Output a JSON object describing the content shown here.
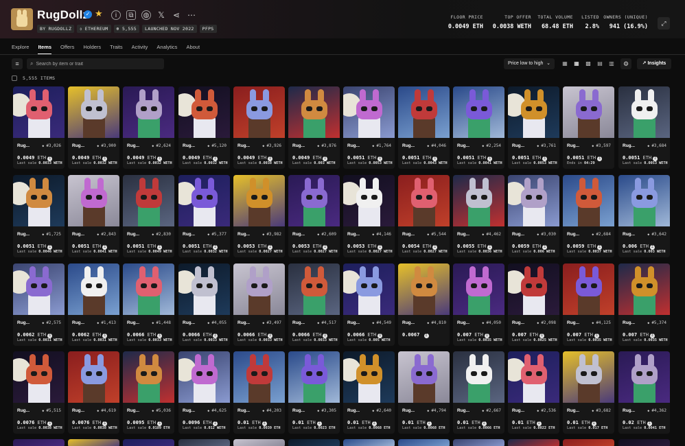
{
  "collection": {
    "name": "RugDollz",
    "chips": [
      "BY RUGDOLLZ",
      "⬨ ETHEREUM",
      "⊕ 5,555",
      "LAUNCHED NOV 2022",
      "PFPS"
    ]
  },
  "stats": [
    {
      "label": "FLOOR PRICE",
      "value": "0.0049 ETH"
    },
    {
      "label": "TOP OFFER",
      "value": "0.0038 WETH"
    },
    {
      "label": "TOTAL VOLUME",
      "value": "68.48 ETH"
    },
    {
      "label": "LISTED",
      "value": "2.8%"
    },
    {
      "label": "OWNERS (UNIQUE)",
      "value": "941 (16.9%)"
    }
  ],
  "tabs": [
    "Explore",
    "Items",
    "Offers",
    "Holders",
    "Traits",
    "Activity",
    "Analytics",
    "About"
  ],
  "active_tab": "Items",
  "toolbar": {
    "search_placeholder": "Search by item or trait",
    "sort_label": "Price low to high",
    "insights_label": "Insights",
    "items_count": "5,555 ITEMS"
  },
  "icons": {
    "info": "info-icon",
    "copy": "copy-icon",
    "web": "globe-icon",
    "x": "x-icon",
    "share": "share-icon",
    "more": "more-icon"
  },
  "colors": {
    "verified": "#2081e2",
    "star": "#f3c33b",
    "background": "#0d0d0d",
    "card": "#171717"
  },
  "items": [
    {
      "name": "Rug...",
      "id": "#3,026",
      "price": "0.0049",
      "unit": "ETH",
      "last": "Last sale",
      "last_value": "0.0033 WETH"
    },
    {
      "name": "Rug...",
      "id": "#3,900",
      "price": "0.0049",
      "unit": "ETH",
      "last": "Last sale",
      "last_value": "0.0032 WETH"
    },
    {
      "name": "Rug...",
      "id": "#2,624",
      "price": "0.0049",
      "unit": "ETH",
      "last": "Last sale",
      "last_value": "0.0032 WETH"
    },
    {
      "name": "Rug...",
      "id": "#5,120",
      "price": "0.0049",
      "unit": "ETH",
      "last": "Last sale",
      "last_value": "0.0032 WETH"
    },
    {
      "name": "Rug...",
      "id": "#3,926",
      "price": "0.0049",
      "unit": "ETH",
      "last": "Last sale",
      "last_value": "0.0038 WETH"
    },
    {
      "name": "Rug...",
      "id": "#3,876",
      "price": "0.0049",
      "unit": "ETH",
      "last": "Last sale",
      "last_value": "0.003 WETH"
    },
    {
      "name": "Rug...",
      "id": "#1,764",
      "price": "0.0051",
      "unit": "ETH",
      "last": "Last sale",
      "last_value": "0.0053 WETH"
    },
    {
      "name": "Rug...",
      "id": "#4,046",
      "price": "0.0051",
      "unit": "ETH",
      "last": "Last sale",
      "last_value": "0.0043 WETH"
    },
    {
      "name": "Rug...",
      "id": "#2,254",
      "price": "0.0051",
      "unit": "ETH",
      "last": "Last sale",
      "last_value": "0.0041 WETH"
    },
    {
      "name": "Rug...",
      "id": "#3,761",
      "price": "0.0051",
      "unit": "ETH",
      "last": "Last sale",
      "last_value": "0.0053 WETH"
    },
    {
      "name": "Rug...",
      "id": "#3,597",
      "price": "0.0051",
      "unit": "ETH",
      "last": "Ends in",
      "last_value": "04:29"
    },
    {
      "name": "Rug...",
      "id": "#3,684",
      "price": "0.0051",
      "unit": "ETH",
      "last": "Last sale",
      "last_value": "0.0053 WETH"
    },
    {
      "name": "Rug...",
      "id": "#1,725",
      "price": "0.0051",
      "unit": "ETH",
      "last": "Last sale",
      "last_value": "0.0046 WETH"
    },
    {
      "name": "Rug...",
      "id": "#2,843",
      "price": "0.0051",
      "unit": "ETH",
      "last": "Last sale",
      "last_value": "0.0041 WETH"
    },
    {
      "name": "Rug...",
      "id": "#2,830",
      "price": "0.0051",
      "unit": "ETH",
      "last": "Last sale",
      "last_value": "0.0049 WETH"
    },
    {
      "name": "Rug...",
      "id": "#5,377",
      "price": "0.0051",
      "unit": "ETH",
      "last": "Last sale",
      "last_value": "0.0032 WETH"
    },
    {
      "name": "Rug...",
      "id": "#3,982",
      "price": "0.0053",
      "unit": "ETH",
      "last": "Last sale",
      "last_value": "0.0027 WETH"
    },
    {
      "name": "Rug...",
      "id": "#2,609",
      "price": "0.0053",
      "unit": "ETH",
      "last": "Last sale",
      "last_value": "0.0027 WETH"
    },
    {
      "name": "Rug...",
      "id": "#4,146",
      "price": "0.0053",
      "unit": "ETH",
      "last": "Last sale",
      "last_value": "0.0027 WETH"
    },
    {
      "name": "Rug...",
      "id": "#5,544",
      "price": "0.0054",
      "unit": "ETH",
      "last": "Last sale",
      "last_value": "0.0027 WETH"
    },
    {
      "name": "Rug...",
      "id": "#4,462",
      "price": "0.0055",
      "unit": "ETH",
      "last": "Last sale",
      "last_value": "0.0036 WETH"
    },
    {
      "name": "Rug...",
      "id": "#3,030",
      "price": "0.0059",
      "unit": "ETH",
      "last": "Last sale",
      "last_value": "0.006 WETH"
    },
    {
      "name": "Rug...",
      "id": "#2,684",
      "price": "0.0059",
      "unit": "ETH",
      "last": "Last sale",
      "last_value": "0.0037 WETH"
    },
    {
      "name": "Rug...",
      "id": "#3,642",
      "price": "0.006",
      "unit": "ETH",
      "last": "Last sale",
      "last_value": "0.003 WETH"
    },
    {
      "name": "Rug...",
      "id": "#2,575",
      "price": "0.0062",
      "unit": "ETH",
      "last": "Last sale",
      "last_value": "0.0031 WETH"
    },
    {
      "name": "Rug...",
      "id": "#1,413",
      "price": "0.0062",
      "unit": "ETH",
      "last": "Last sale",
      "last_value": "0.0031 WETH"
    },
    {
      "name": "Rug...",
      "id": "#1,448",
      "price": "0.0066",
      "unit": "ETH",
      "last": "Last sale",
      "last_value": "0.0033 WETH"
    },
    {
      "name": "Rug...",
      "id": "#4,055",
      "price": "0.0066",
      "unit": "ETH",
      "last": "Last sale",
      "last_value": "0.0033 WETH"
    },
    {
      "name": "Rug...",
      "id": "#3,497",
      "price": "0.0066",
      "unit": "ETH",
      "last": "Last sale",
      "last_value": "0.0033 WETH"
    },
    {
      "name": "Rug...",
      "id": "#4,517",
      "price": "0.0066",
      "unit": "ETH",
      "last": "Last sale",
      "last_value": "0.0033 WETH"
    },
    {
      "name": "Rug...",
      "id": "#4,549",
      "price": "0.0066",
      "unit": "ETH",
      "last": "Last sale",
      "last_value": "0.005 WETH"
    },
    {
      "name": "Rug...",
      "id": "#4,810",
      "price": "0.0067",
      "unit": "",
      "last": "",
      "last_value": ""
    },
    {
      "name": "Rug...",
      "id": "#4,050",
      "price": "0.007",
      "unit": "ETH",
      "last": "Last sale",
      "last_value": "0.0035 WETH"
    },
    {
      "name": "Rug...",
      "id": "#2,098",
      "price": "0.007",
      "unit": "ETH",
      "last": "Last sale",
      "last_value": "0.0025 WETH"
    },
    {
      "name": "Rug...",
      "id": "#4,125",
      "price": "0.007",
      "unit": "ETH",
      "last": "Last sale",
      "last_value": "0.0035 WETH"
    },
    {
      "name": "Rug...",
      "id": "#5,374",
      "price": "0.007",
      "unit": "ETH",
      "last": "Last sale",
      "last_value": "0.0035 WETH"
    },
    {
      "name": "Rug...",
      "id": "#5,515",
      "price": "0.0076",
      "unit": "ETH",
      "last": "Last sale",
      "last_value": "0.0038 WETH"
    },
    {
      "name": "Rug...",
      "id": "#4,619",
      "price": "0.0076",
      "unit": "ETH",
      "last": "Last sale",
      "last_value": "0.0038 WETH"
    },
    {
      "name": "Rug...",
      "id": "#5,036",
      "price": "0.0095",
      "unit": "ETH",
      "last": "Last sale",
      "last_value": "0.0189 ETH"
    },
    {
      "name": "Rug...",
      "id": "#4,625",
      "price": "0.0096",
      "unit": "ETH",
      "last": "Last sale",
      "last_value": "0.012 WETH"
    },
    {
      "name": "Rug...",
      "id": "#4,203",
      "price": "0.01",
      "unit": "ETH",
      "last": "Last sale",
      "last_value": "0.0039 ETH"
    },
    {
      "name": "Rug...",
      "id": "#3,305",
      "price": "0.01",
      "unit": "ETH",
      "last": "Last sale",
      "last_value": "0.0023 ETH"
    },
    {
      "name": "Rug...",
      "id": "#2,640",
      "price": "0.01",
      "unit": "ETH",
      "last": "Last sale",
      "last_value": "0.0068 ETH"
    },
    {
      "name": "Rug...",
      "id": "#4,794",
      "price": "0.01",
      "unit": "ETH",
      "last": "Last sale",
      "last_value": "0.0068 ETH"
    },
    {
      "name": "Rug...",
      "id": "#2,667",
      "price": "0.01",
      "unit": "ETH",
      "last": "Last sale",
      "last_value": "0.0066 ETH"
    },
    {
      "name": "Rug...",
      "id": "#2,536",
      "price": "0.01",
      "unit": "ETH",
      "last": "Last sale",
      "last_value": "0.0022 ETH"
    },
    {
      "name": "Rug...",
      "id": "#3,682",
      "price": "0.01",
      "unit": "ETH",
      "last": "Last sale",
      "last_value": "0.017 ETH"
    },
    {
      "name": "Rug...",
      "id": "#4,362",
      "price": "0.02",
      "unit": "ETH",
      "last": "Last sale",
      "last_value": "0.0041 ETH"
    }
  ]
}
